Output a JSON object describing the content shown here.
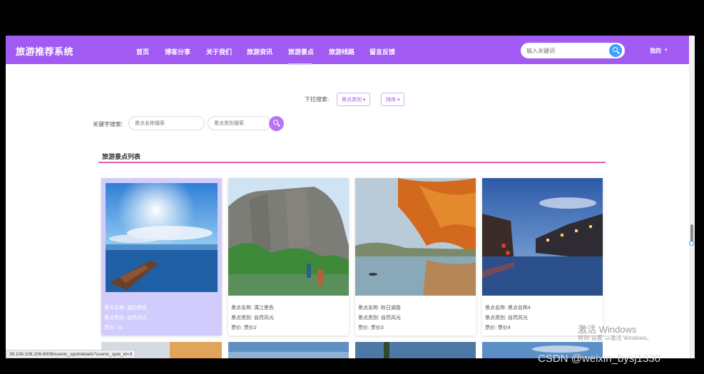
{
  "app": {
    "title": "旅游推荐系统"
  },
  "nav": {
    "items": [
      {
        "label": "首页"
      },
      {
        "label": "博客分享"
      },
      {
        "label": "关于我们"
      },
      {
        "label": "旅游资讯"
      },
      {
        "label": "旅游景点"
      },
      {
        "label": "旅游线路"
      },
      {
        "label": "留言反馈"
      }
    ],
    "active": "旅游景点",
    "search_placeholder": "输入关键词",
    "mine": "我的"
  },
  "filters": {
    "dropdown_label": "下拉搜索:",
    "category": "景点类别",
    "sort": "排序",
    "keyword_label": "关键字搜索:",
    "name_placeholder": "景点名称搜索",
    "type_placeholder": "景点类别搜索"
  },
  "section": {
    "title": "旅游景点列表"
  },
  "cards": [
    {
      "name": "景点名称: 湖边景色",
      "type": "景点类别: 自然风光",
      "price": "票价: 30"
    },
    {
      "name": "景点名称: 漓江景色",
      "type": "景点类别: 自然风光",
      "price": "票价: 票价2"
    },
    {
      "name": "景点名称: 秋日湖面",
      "type": "景点类别: 自然风光",
      "price": "票价: 票价3"
    },
    {
      "name": "景点名称: 景点名称4",
      "type": "景点类别: 自然风光",
      "price": "票价: 票价4"
    }
  ],
  "status_url": "39.108.108.206:8009/scenic_spot/details?scenic_spot_id=3",
  "watermark": {
    "activate_title": "激活 Windows",
    "activate_sub": "转到\"设置\"以激活 Windows。",
    "csdn": "CSDN @weixin_bysj1330"
  },
  "colors": {
    "navbar": "#a25bf2",
    "search_button": "#409eff",
    "section_line": "#e75fb5",
    "active_card": "#d1ccfb"
  }
}
